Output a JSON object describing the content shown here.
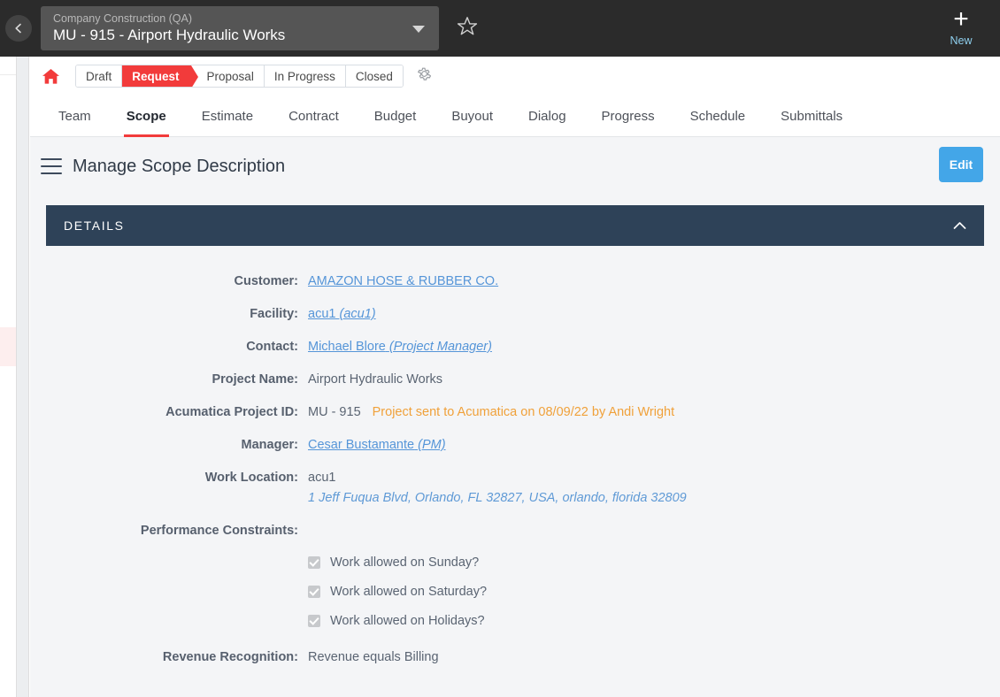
{
  "topbar": {
    "back_icon": "chevron-left-icon",
    "company": "Company Construction (QA)",
    "project": "MU - 915 - Airport Hydraulic Works",
    "dropdown_icon": "chevron-down-icon",
    "favorite_icon": "star-icon",
    "new_plus": "+",
    "new_label": "New",
    "new_label_color": "#8fd0ef",
    "background": "#2b2b2b"
  },
  "pipeline": {
    "home_icon": "home-icon",
    "gear_icon": "gear-icon",
    "active_color": "#f23b3b",
    "steps": [
      {
        "label": "Draft",
        "active": false
      },
      {
        "label": "Request",
        "active": true
      },
      {
        "label": "Proposal",
        "active": false
      },
      {
        "label": "In Progress",
        "active": false
      },
      {
        "label": "Closed",
        "active": false
      }
    ]
  },
  "tabs": {
    "active": "Scope",
    "items": [
      {
        "label": "Team"
      },
      {
        "label": "Scope"
      },
      {
        "label": "Estimate"
      },
      {
        "label": "Contract"
      },
      {
        "label": "Budget"
      },
      {
        "label": "Buyout"
      },
      {
        "label": "Dialog"
      },
      {
        "label": "Progress"
      },
      {
        "label": "Schedule"
      },
      {
        "label": "Submittals"
      }
    ]
  },
  "page": {
    "menu_icon": "hamburger-icon",
    "title": "Manage Scope Description",
    "edit_label": "Edit",
    "edit_color": "#43a6e8"
  },
  "details": {
    "header": "DETAILS",
    "header_bg": "#2e4258",
    "collapse_icon": "chevron-up-icon",
    "fields": {
      "customer_label": "Customer:",
      "customer_value": "AMAZON HOSE & RUBBER CO.",
      "facility_label": "Facility:",
      "facility_value": "acu1",
      "facility_value_italic": "(acu1)",
      "contact_label": "Contact:",
      "contact_value": "Michael Blore",
      "contact_value_italic": "(Project Manager)",
      "project_name_label": "Project Name:",
      "project_name_value": "Airport Hydraulic Works",
      "acumatica_label": "Acumatica Project ID:",
      "acumatica_value": "MU - 915",
      "acumatica_note": "Project sent to Acumatica on 08/09/22 by Andi Wright",
      "acumatica_note_color": "#f0a13a",
      "manager_label": "Manager:",
      "manager_value": "Cesar Bustamante",
      "manager_value_italic": "(PM)",
      "work_location_label": "Work Location:",
      "work_location_value": "acu1",
      "work_location_address": "1 Jeff Fuqua Blvd, Orlando, FL 32827, USA, orlando, florida 32809",
      "performance_label": "Performance Constraints:",
      "revenue_label": "Revenue Recognition:",
      "revenue_value": "Revenue equals Billing"
    },
    "constraints": [
      {
        "label": "Work allowed on Sunday?",
        "checked": true
      },
      {
        "label": "Work allowed on Saturday?",
        "checked": true
      },
      {
        "label": "Work allowed on Holidays?",
        "checked": true
      }
    ]
  }
}
